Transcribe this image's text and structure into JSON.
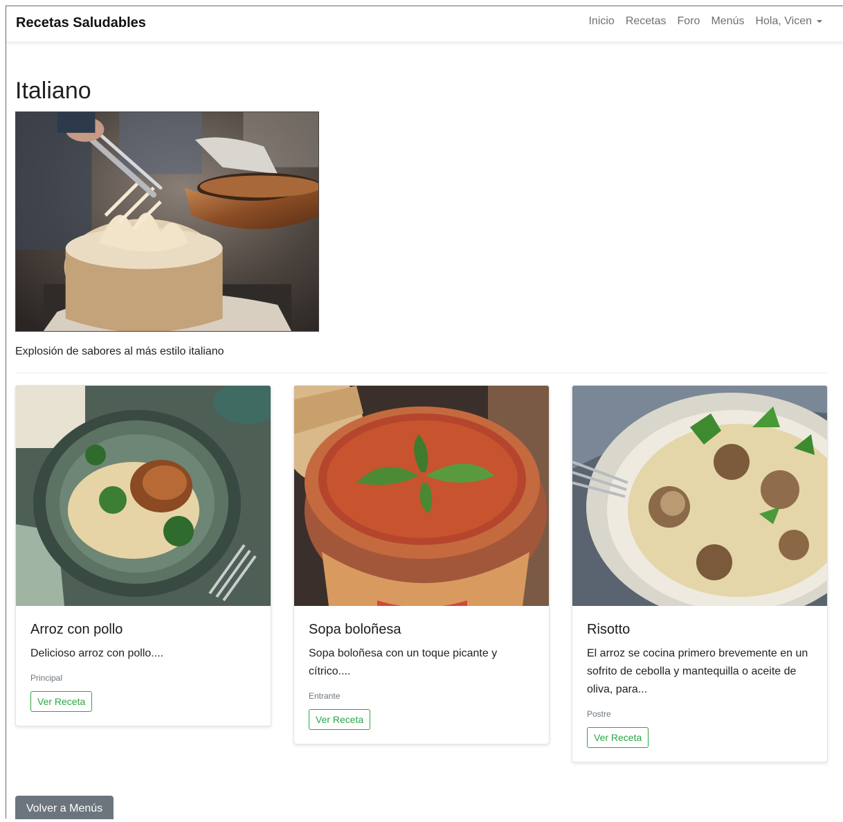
{
  "navbar": {
    "brand": "Recetas Saludables",
    "links": [
      "Inicio",
      "Recetas",
      "Foro",
      "Menús"
    ],
    "user_menu": "Hola, Vicen"
  },
  "menu": {
    "title": "Italiano",
    "description": "Explosión de sabores al más estilo italiano"
  },
  "recipes": [
    {
      "title": "Arroz con pollo",
      "text": "Delicioso arroz con pollo....",
      "category": "Principal",
      "button": "Ver Receta"
    },
    {
      "title": "Sopa boloñesa",
      "text": "Sopa boloñesa con un toque picante y cítrico....",
      "category": "Entrante",
      "button": "Ver Receta"
    },
    {
      "title": "Risotto",
      "text": "El arroz se cocina primero brevemente en un sofrito de cebolla y mantequilla o aceite de oliva, para...",
      "category": "Postre",
      "button": "Ver Receta"
    }
  ],
  "back_button": "Volver a Menús",
  "colors": {
    "accent_green": "#28a745",
    "secondary_gray": "#6c757d"
  }
}
